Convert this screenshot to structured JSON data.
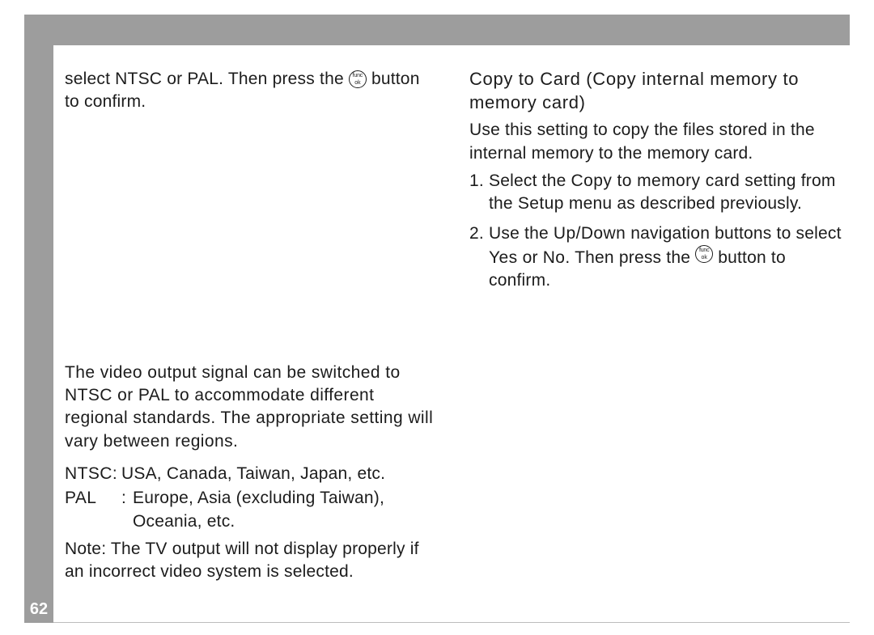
{
  "page_number": "62",
  "left": {
    "intro_a": "select NTSC or PAL. Then press the ",
    "intro_b": " button to confirm.",
    "signal_para": "The video output signal can be switched to NTSC or PAL to accommodate different regional standards. The appropriate setting will vary between regions.",
    "defs": [
      {
        "term": "NTSC:",
        "desc": "USA, Canada, Taiwan, Japan, etc."
      },
      {
        "term": "PAL",
        "colon": ":",
        "desc": "Europe, Asia (excluding Taiwan), Oceania, etc."
      }
    ],
    "note": "Note: The TV output will not display properly if an incorrect video system is selected."
  },
  "right": {
    "heading": "Copy to Card (Copy internal memory to memory card)",
    "sub": "Use this setting to copy the files stored in the internal memory to the memory card.",
    "step1_a": "Select the ",
    "step1_label1": "Copy to memory card",
    "step1_b": " setting from the ",
    "step1_label2": "Setup",
    "step1_c": " menu as described previously.",
    "step2_a": "Use the ",
    "step2_label1": "Up/Down",
    "step2_b": " navigation buttons to select ",
    "step2_label2": "Yes",
    "step2_c": " or ",
    "step2_label3": "No",
    "step2_d": ". Then press the ",
    "step2_e": " button to confirm."
  },
  "button": {
    "top": "func",
    "bot": "ok"
  }
}
